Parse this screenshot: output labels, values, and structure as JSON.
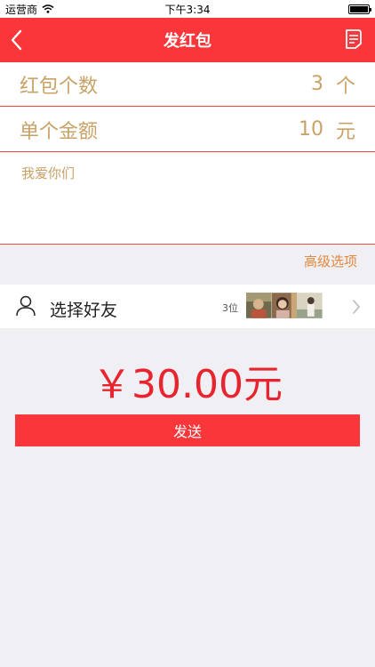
{
  "status_bar": {
    "carrier": "运营商",
    "time": "下午3:34"
  },
  "nav": {
    "title": "发红包",
    "back_icon": "chevron-left-icon",
    "record_icon": "document-icon"
  },
  "form": {
    "count_label": "红包个数",
    "count_value": "3",
    "count_unit": "个",
    "amount_label": "单个金额",
    "amount_value": "10",
    "amount_unit": "元",
    "message_placeholder": "我爱你们"
  },
  "advanced_label": "高级选项",
  "friends": {
    "icon": "person-icon",
    "label": "选择好友",
    "count": "3位"
  },
  "total": "￥30.00元",
  "send_label": "发送",
  "colors": {
    "brand_red": "#f9373a",
    "label_gold": "#c8a266",
    "advanced_orange": "#e4883f",
    "amount_red": "#e8252e"
  }
}
